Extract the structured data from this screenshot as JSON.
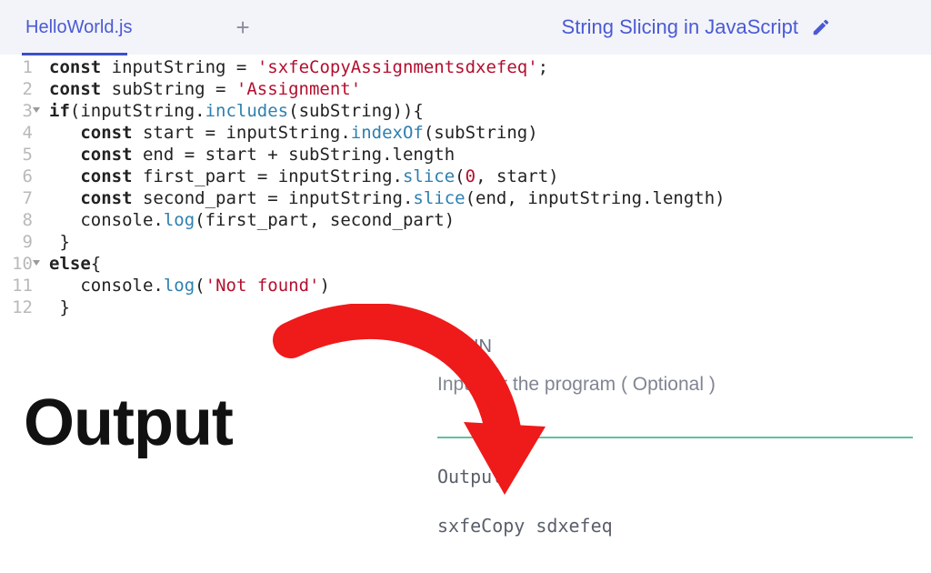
{
  "header": {
    "tab_name": "HelloWorld.js",
    "title": "String Slicing in JavaScript"
  },
  "code": {
    "lines": [
      {
        "n": 1,
        "fold": false,
        "tokens": [
          [
            "kw",
            "const "
          ],
          [
            "id",
            "inputString "
          ],
          [
            "pun",
            "= "
          ],
          [
            "str",
            "'sxfeCopyAssignmentsdxefeq'"
          ],
          [
            "pun",
            ";"
          ]
        ]
      },
      {
        "n": 2,
        "fold": false,
        "tokens": [
          [
            "kw",
            "const "
          ],
          [
            "id",
            "subString "
          ],
          [
            "pun",
            "= "
          ],
          [
            "str",
            "'Assignment'"
          ]
        ]
      },
      {
        "n": 3,
        "fold": true,
        "tokens": [
          [
            "kw",
            "if"
          ],
          [
            "pun",
            "(inputString."
          ],
          [
            "fn",
            "includes"
          ],
          [
            "pun",
            "(subString)){"
          ]
        ]
      },
      {
        "n": 4,
        "fold": false,
        "tokens": [
          [
            "id",
            "   "
          ],
          [
            "kw",
            "const "
          ],
          [
            "id",
            "start "
          ],
          [
            "pun",
            "= inputString."
          ],
          [
            "fn2",
            "indexOf"
          ],
          [
            "pun",
            "(subString)"
          ]
        ]
      },
      {
        "n": 5,
        "fold": false,
        "tokens": [
          [
            "id",
            "   "
          ],
          [
            "kw",
            "const "
          ],
          [
            "id",
            "end "
          ],
          [
            "pun",
            "= start + subString.length"
          ]
        ]
      },
      {
        "n": 6,
        "fold": false,
        "tokens": [
          [
            "id",
            "   "
          ],
          [
            "kw",
            "const "
          ],
          [
            "id",
            "first_part "
          ],
          [
            "pun",
            "= inputString."
          ],
          [
            "fn",
            "slice"
          ],
          [
            "pun",
            "("
          ],
          [
            "num",
            "0"
          ],
          [
            "pun",
            ", start)"
          ]
        ]
      },
      {
        "n": 7,
        "fold": false,
        "tokens": [
          [
            "id",
            "   "
          ],
          [
            "kw",
            "const "
          ],
          [
            "id",
            "second_part "
          ],
          [
            "pun",
            "= inputString."
          ],
          [
            "fn",
            "slice"
          ],
          [
            "pun",
            "(end, inputString.length)"
          ]
        ]
      },
      {
        "n": 8,
        "fold": false,
        "tokens": [
          [
            "id",
            "   console."
          ],
          [
            "fn",
            "log"
          ],
          [
            "pun",
            "(first_part, second_part)"
          ]
        ]
      },
      {
        "n": 9,
        "fold": false,
        "tokens": [
          [
            "id",
            " "
          ],
          [
            "pun",
            "}"
          ]
        ]
      },
      {
        "n": 10,
        "fold": true,
        "tokens": [
          [
            "kw",
            "else"
          ],
          [
            "pun",
            "{"
          ]
        ]
      },
      {
        "n": 11,
        "fold": false,
        "tokens": [
          [
            "id",
            "   console."
          ],
          [
            "fn",
            "log"
          ],
          [
            "pun",
            "("
          ],
          [
            "str",
            "'Not found'"
          ],
          [
            "pun",
            ")"
          ]
        ]
      },
      {
        "n": 12,
        "fold": false,
        "tokens": [
          [
            "id",
            " "
          ],
          [
            "pun",
            "}"
          ]
        ]
      }
    ]
  },
  "stdin": {
    "title": "STDIN",
    "placeholder": "Input for the program ( Optional )"
  },
  "output": {
    "label": "Output:",
    "value": "sxfeCopy sdxefeq"
  },
  "annotation": {
    "big_label": "Output"
  }
}
